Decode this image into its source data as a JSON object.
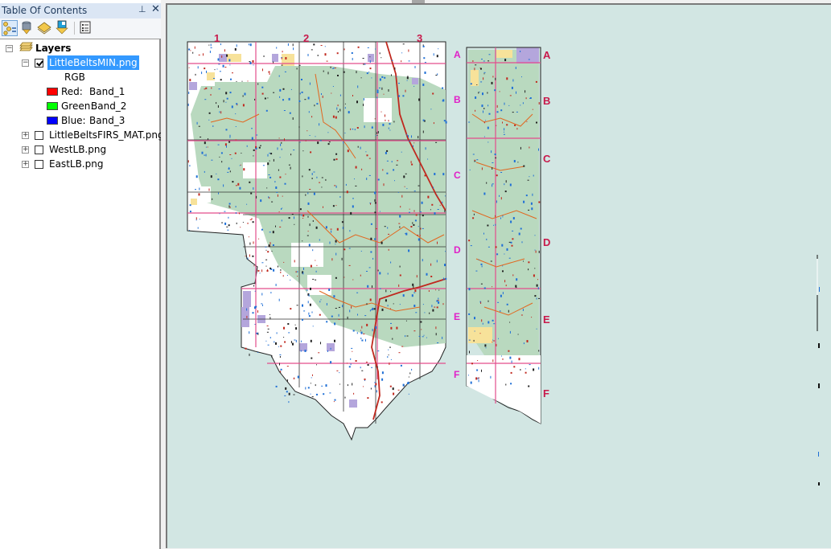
{
  "toc": {
    "title": "Table Of Contents",
    "pin_glyph": "⊥",
    "close_glyph": "✕",
    "toolbar": [
      {
        "name": "list-by-drawing-order",
        "icon": "list-by-drawing-order-icon",
        "active": true
      },
      {
        "name": "list-by-source",
        "icon": "database-icon",
        "active": false
      },
      {
        "name": "list-by-visibility",
        "icon": "layers-icon",
        "active": false
      },
      {
        "name": "list-by-selection",
        "icon": "selection-icon",
        "active": false
      },
      {
        "name": "options",
        "icon": "options-list-icon",
        "active": false
      }
    ],
    "root_label": "Layers",
    "layers": [
      {
        "name": "LittleBeltsMIN.png",
        "checked": true,
        "expanded": true,
        "selected": true,
        "renderer": "RGB",
        "bands": [
          {
            "channel": "Red:",
            "band": "Band_1",
            "color": "#ff0000"
          },
          {
            "channel": "Green:",
            "band": "Band_2",
            "color": "#00ff00"
          },
          {
            "channel": "Blue:",
            "band": "Band_3",
            "color": "#0000ff"
          }
        ]
      },
      {
        "name": "LittleBeltsFIRS_MAT.png",
        "checked": false,
        "expanded": false
      },
      {
        "name": "WestLB.png",
        "checked": false,
        "expanded": false
      },
      {
        "name": "EastLB.png",
        "checked": false,
        "expanded": false
      }
    ]
  },
  "map": {
    "background_color": "#d2e6e3",
    "west_sheet": {
      "column_labels": [
        "1",
        "2",
        "3"
      ],
      "label_color": "#c8194b"
    },
    "east_sheet": {
      "row_labels_left": [
        "A",
        "B",
        "C",
        "D",
        "E",
        "F"
      ],
      "row_labels_right": [
        "A",
        "B",
        "C",
        "D",
        "E",
        "F"
      ],
      "left_label_color": "#e020c8",
      "right_label_color": "#c8194b"
    },
    "colors": {
      "forest": "#b9d9bf",
      "private": "#ffffff",
      "state": "#b4a6dc",
      "blm": "#f7e29a",
      "grid": "#e34d8c",
      "road": "#c0281e",
      "trail": "#e2661e",
      "stream": "#1f6fd6",
      "boundary": "#222222"
    }
  }
}
